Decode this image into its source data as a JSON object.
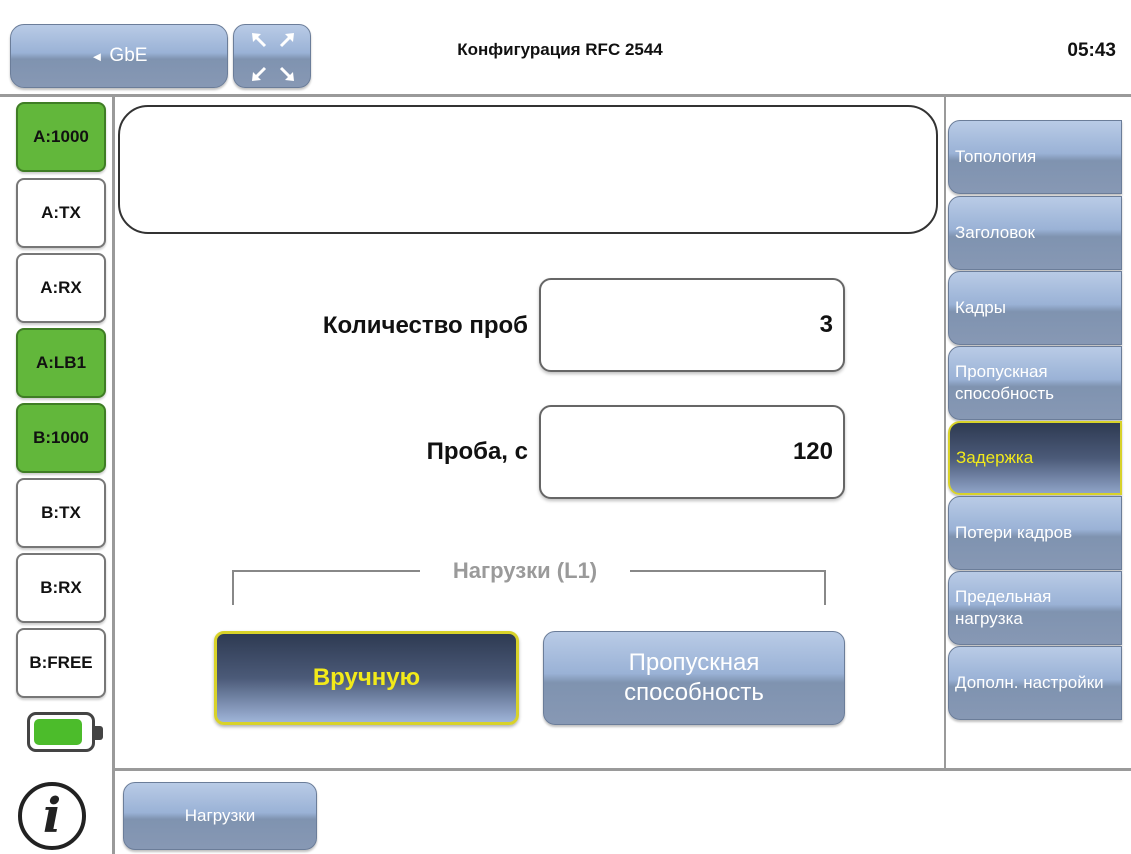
{
  "header": {
    "back_label": "GbE",
    "back_arrow": "◄",
    "title": "Конфигурация RFC 2544",
    "clock": "05:43"
  },
  "left": {
    "buttons": [
      {
        "label": "A:1000",
        "active": true
      },
      {
        "label": "A:TX",
        "active": false
      },
      {
        "label": "A:RX",
        "active": false
      },
      {
        "label": "A:LB1",
        "active": true
      },
      {
        "label": "B:1000",
        "active": true
      },
      {
        "label": "B:TX",
        "active": false
      },
      {
        "label": "B:RX",
        "active": false
      },
      {
        "label": "B:FREE",
        "active": false
      }
    ],
    "battery_level": 0.85,
    "info_glyph": "i"
  },
  "main": {
    "fields": [
      {
        "label": "Количество проб",
        "value": "3"
      },
      {
        "label": "Проба, с",
        "value": "120"
      }
    ],
    "group_caption": "Нагрузки (L1)",
    "mode_buttons": [
      {
        "label": "Вручную",
        "selected": true
      },
      {
        "label": "Пропускная способность",
        "selected": false
      }
    ]
  },
  "right_tabs": [
    {
      "label": "Топология",
      "active": false
    },
    {
      "label": "Заголовок",
      "active": false
    },
    {
      "label": "Кадры",
      "active": false
    },
    {
      "label": "Пропускная способность",
      "active": false
    },
    {
      "label": "Задержка",
      "active": true
    },
    {
      "label": "Потери кадров",
      "active": false
    },
    {
      "label": "Предельная нагрузка",
      "active": false
    },
    {
      "label": "Дополн. настройки",
      "active": false
    }
  ],
  "bottom": {
    "loads_button": "Нагрузки"
  },
  "colors": {
    "active_green": "#62b73b",
    "accent_yellow": "#f2ea1a",
    "button_blue": "#9ab2d6"
  }
}
